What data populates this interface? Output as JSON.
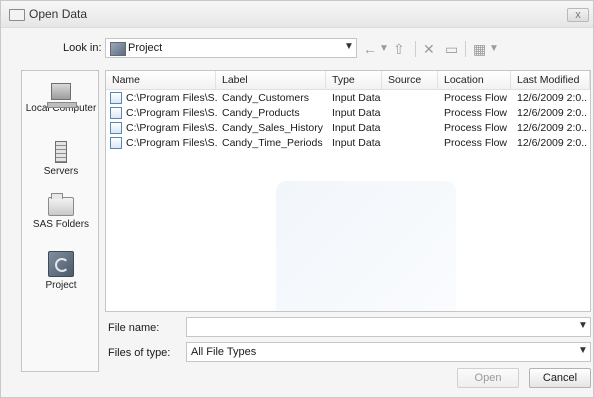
{
  "window": {
    "title": "Open Data",
    "close_label": "x"
  },
  "lookin": {
    "label": "Look in:",
    "value": "Project"
  },
  "places": [
    {
      "label": "Local Computer",
      "icon": "computer-icon"
    },
    {
      "label": "Servers",
      "icon": "server-icon"
    },
    {
      "label": "SAS Folders",
      "icon": "folder-icon"
    },
    {
      "label": "Project",
      "icon": "project-icon"
    }
  ],
  "filelist": {
    "columns": [
      "Name",
      "Label",
      "Type",
      "Source",
      "Location",
      "Last Modified"
    ],
    "rows": [
      {
        "name": "C:\\Program Files\\S...",
        "label": "Candy_Customers",
        "type": "Input Data",
        "source": "",
        "location": "Process Flow",
        "last_modified": "12/6/2009 2:0..."
      },
      {
        "name": "C:\\Program Files\\S...",
        "label": "Candy_Products",
        "type": "Input Data",
        "source": "",
        "location": "Process Flow",
        "last_modified": "12/6/2009 2:0..."
      },
      {
        "name": "C:\\Program Files\\S...",
        "label": "Candy_Sales_History",
        "type": "Input Data",
        "source": "",
        "location": "Process Flow",
        "last_modified": "12/6/2009 2:0..."
      },
      {
        "name": "C:\\Program Files\\S...",
        "label": "Candy_Time_Periods",
        "type": "Input Data",
        "source": "",
        "location": "Process Flow",
        "last_modified": "12/6/2009 2:0..."
      }
    ]
  },
  "form": {
    "file_name_label": "File name:",
    "file_name_value": "",
    "files_of_type_label": "Files of type:",
    "files_of_type_value": "All File Types"
  },
  "buttons": {
    "open": "Open",
    "cancel": "Cancel"
  }
}
